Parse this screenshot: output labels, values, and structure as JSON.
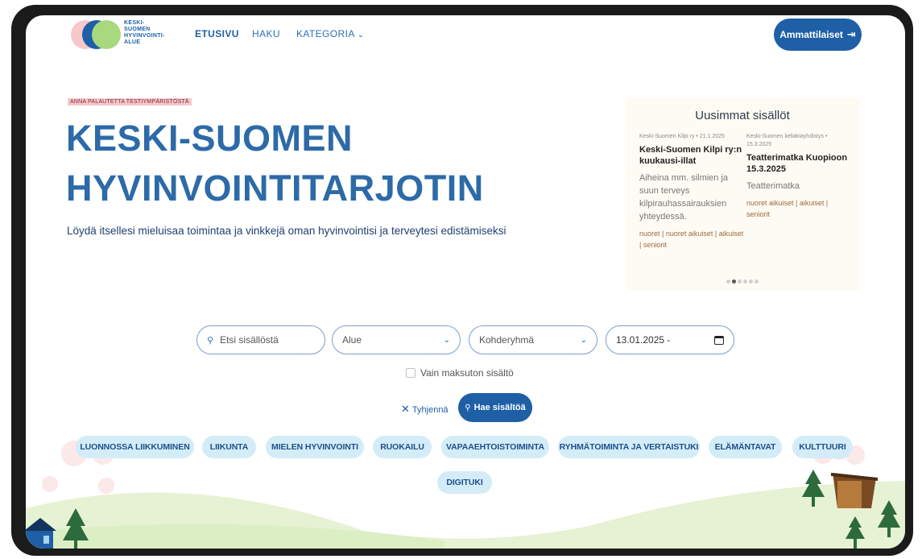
{
  "header": {
    "logo_lines": [
      "KESKI-",
      "SUOMEN",
      "HYVINVOINTI-",
      "ALUE"
    ],
    "nav": {
      "etusivu": "ETUSIVU",
      "haku": "HAKU",
      "kategoria": "KATEGORIA"
    },
    "pro_button": "Ammattilaiset"
  },
  "hero": {
    "tag": "ANNA PALAUTETTA TESTIYMPÄRISTÖSTÄ",
    "title": "KESKI-SUOMEN HYVINVOINTITARJOTIN",
    "subtitle": "Löydä itsellesi mieluisaa toimintaa ja vinkkejä oman hyvinvointisi ja terveytesi edistämiseksi"
  },
  "latest": {
    "title": "Uusimmat sisällöt",
    "cards": [
      {
        "meta": "Keski-Suomen Kilpi ry • 21.1.2025",
        "title": "Keski-Suomen Kilpi ry:n kuukausi-illat",
        "desc": "Aiheina mm. silmien ja suun terveys kilpirauhassairauksien yhteydessä.",
        "tags": "nuoret | nuoret aikuiset | aikuiset | seniorit"
      },
      {
        "meta": "Keski-Suomen keliakiayhdistys • 15.3.2025",
        "title": "Teatterimatka Kuopioon 15.3.2025",
        "desc": "Teatterimatka",
        "tags": "nuoret aikuiset | aikuiset | seniorit"
      }
    ],
    "dots_count": 6,
    "active_dot": 1
  },
  "search": {
    "placeholder": "Etsi sisällöstä",
    "alue": "Alue",
    "kohderyhma": "Kohderyhmä",
    "date": "13.01.2025 -",
    "free_only": "Vain maksuton sisältö",
    "clear": "Tyhjennä",
    "submit": "Hae sisältöä"
  },
  "categories": [
    "LUONNOSSA LIIKKUMINEN",
    "LIIKUNTA",
    "MIELEN HYVINVOINTI",
    "RUOKAILU",
    "VAPAAEHTOISTOIMINTA",
    "RYHMÄTOIMINTA JA VERTAISTUKI",
    "ELÄMÄNTAVAT",
    "KULTTUURI",
    "DIGITUKI"
  ],
  "colors": {
    "primary": "#1e5fa6",
    "hero_title": "#2d6aa8",
    "chip_bg": "#d3ecf8",
    "hill": "#e6f2d3",
    "tree": "#2e6b3c"
  }
}
